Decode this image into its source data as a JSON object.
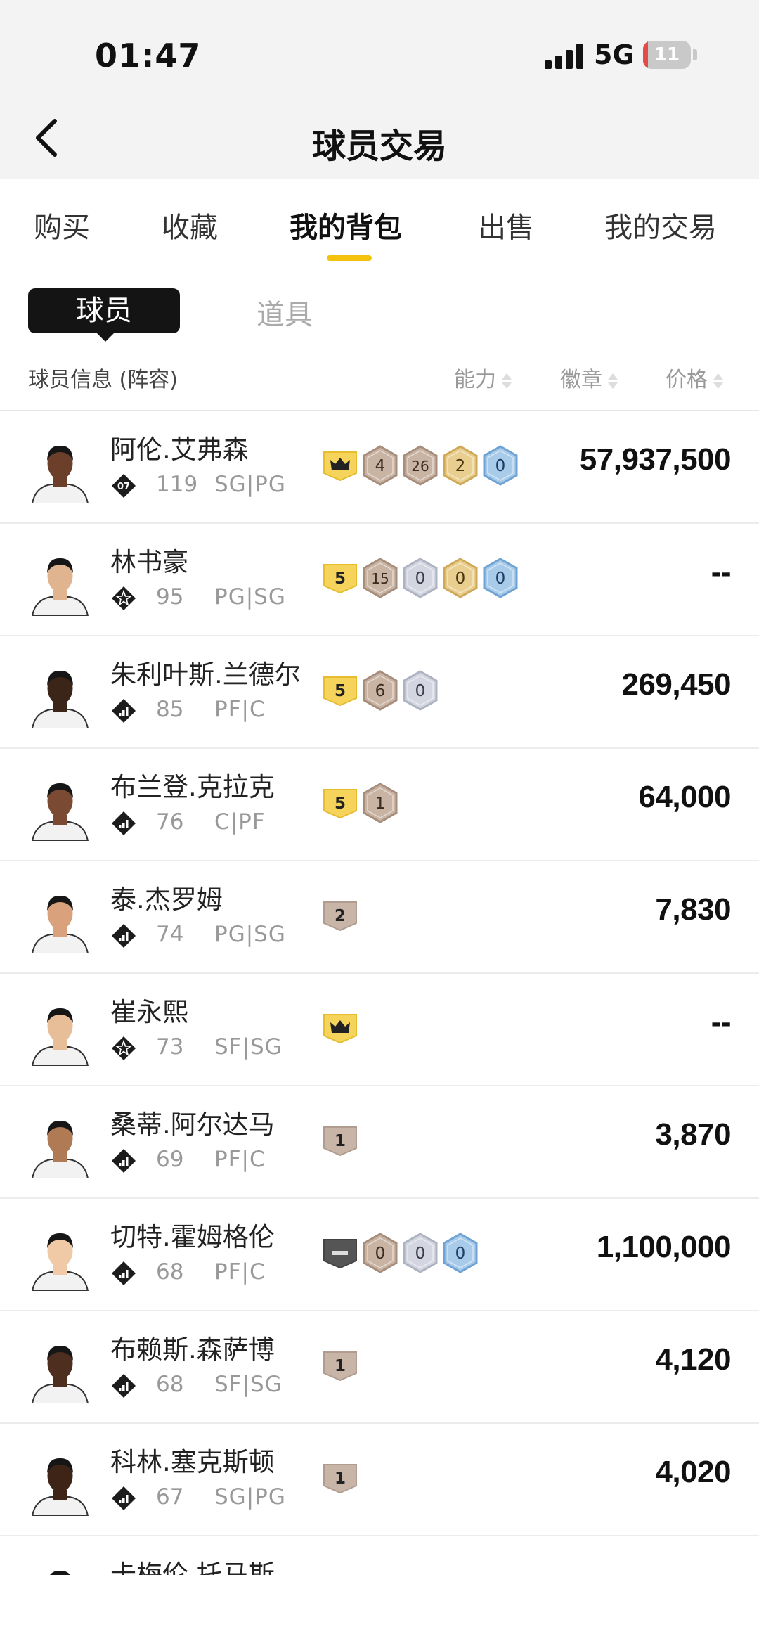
{
  "status_bar": {
    "time": "01:47",
    "network": "5G",
    "battery": "11",
    "battery_level": 0.11
  },
  "header": {
    "title": "球员交易"
  },
  "main_tabs": [
    {
      "label": "购买",
      "active": false
    },
    {
      "label": "收藏",
      "active": false
    },
    {
      "label": "我的背包",
      "active": true
    },
    {
      "label": "出售",
      "active": false
    },
    {
      "label": "我的交易",
      "active": false
    }
  ],
  "sub_tabs": [
    {
      "label": "球员",
      "active": true
    },
    {
      "label": "道具",
      "active": false
    }
  ],
  "columns": {
    "info": "球员信息 (阵容)",
    "rating": "能力",
    "badges": "徽章",
    "price": "价格"
  },
  "colors": {
    "accent": "#f4c20d",
    "active_tab_bg": "#141414",
    "price": "#111111",
    "muted": "#999999"
  },
  "players": [
    {
      "name": "阿伦.艾弗森",
      "pos_icon": "number-07-icon",
      "pos_tag": "07",
      "ovr": "119",
      "position": "SG|PG",
      "badges": [
        {
          "type": "crown",
          "label": ""
        },
        {
          "type": "bronze",
          "label": "4"
        },
        {
          "type": "bronze",
          "label": "26"
        },
        {
          "type": "gold",
          "label": "2"
        },
        {
          "type": "blue",
          "label": "0"
        }
      ],
      "price": "57,937,500"
    },
    {
      "name": "林书豪",
      "pos_icon": "star-icon",
      "pos_tag": "",
      "ovr": "95",
      "position": "PG|SG",
      "badges": [
        {
          "type": "level",
          "label": "5"
        },
        {
          "type": "bronze",
          "label": "15"
        },
        {
          "type": "silver",
          "label": "0"
        },
        {
          "type": "gold",
          "label": "0"
        },
        {
          "type": "blue",
          "label": "0"
        }
      ],
      "price": "--"
    },
    {
      "name": "朱利叶斯.兰德尔",
      "pos_icon": "bars-icon",
      "pos_tag": "",
      "ovr": "85",
      "position": "PF|C",
      "badges": [
        {
          "type": "level",
          "label": "5"
        },
        {
          "type": "bronze",
          "label": "6"
        },
        {
          "type": "silver",
          "label": "0"
        }
      ],
      "price": "269,450"
    },
    {
      "name": "布兰登.克拉克",
      "pos_icon": "bars-icon",
      "pos_tag": "",
      "ovr": "76",
      "position": "C|PF",
      "badges": [
        {
          "type": "level",
          "label": "5"
        },
        {
          "type": "bronze",
          "label": "1"
        }
      ],
      "price": "64,000"
    },
    {
      "name": "泰.杰罗姆",
      "pos_icon": "bars-icon",
      "pos_tag": "",
      "ovr": "74",
      "position": "PG|SG",
      "badges": [
        {
          "type": "tan",
          "label": "2"
        }
      ],
      "price": "7,830"
    },
    {
      "name": "崔永熙",
      "pos_icon": "star-icon",
      "pos_tag": "",
      "ovr": "73",
      "position": "SF|SG",
      "badges": [
        {
          "type": "crown",
          "label": ""
        }
      ],
      "price": "--"
    },
    {
      "name": "桑蒂.阿尔达马",
      "pos_icon": "bars-icon",
      "pos_tag": "",
      "ovr": "69",
      "position": "PF|C",
      "badges": [
        {
          "type": "tan",
          "label": "1"
        }
      ],
      "price": "3,870"
    },
    {
      "name": "切特.霍姆格伦",
      "pos_icon": "bars-icon",
      "pos_tag": "",
      "ovr": "68",
      "position": "PF|C",
      "badges": [
        {
          "type": "dark",
          "label": ""
        },
        {
          "type": "bronze",
          "label": "0"
        },
        {
          "type": "silver",
          "label": "0"
        },
        {
          "type": "blue",
          "label": "0"
        }
      ],
      "price": "1,100,000"
    },
    {
      "name": "布赖斯.森萨博",
      "pos_icon": "bars-icon",
      "pos_tag": "",
      "ovr": "68",
      "position": "SF|SG",
      "badges": [
        {
          "type": "tan",
          "label": "1"
        }
      ],
      "price": "4,120"
    },
    {
      "name": "科林.塞克斯顿",
      "pos_icon": "bars-icon",
      "pos_tag": "",
      "ovr": "67",
      "position": "SG|PG",
      "badges": [
        {
          "type": "tan",
          "label": "1"
        }
      ],
      "price": "4,020"
    },
    {
      "name": "卡梅伦.托马斯",
      "pos_icon": "bars-icon",
      "pos_tag": "",
      "ovr": "",
      "position": "",
      "badges": [],
      "price": ""
    }
  ]
}
